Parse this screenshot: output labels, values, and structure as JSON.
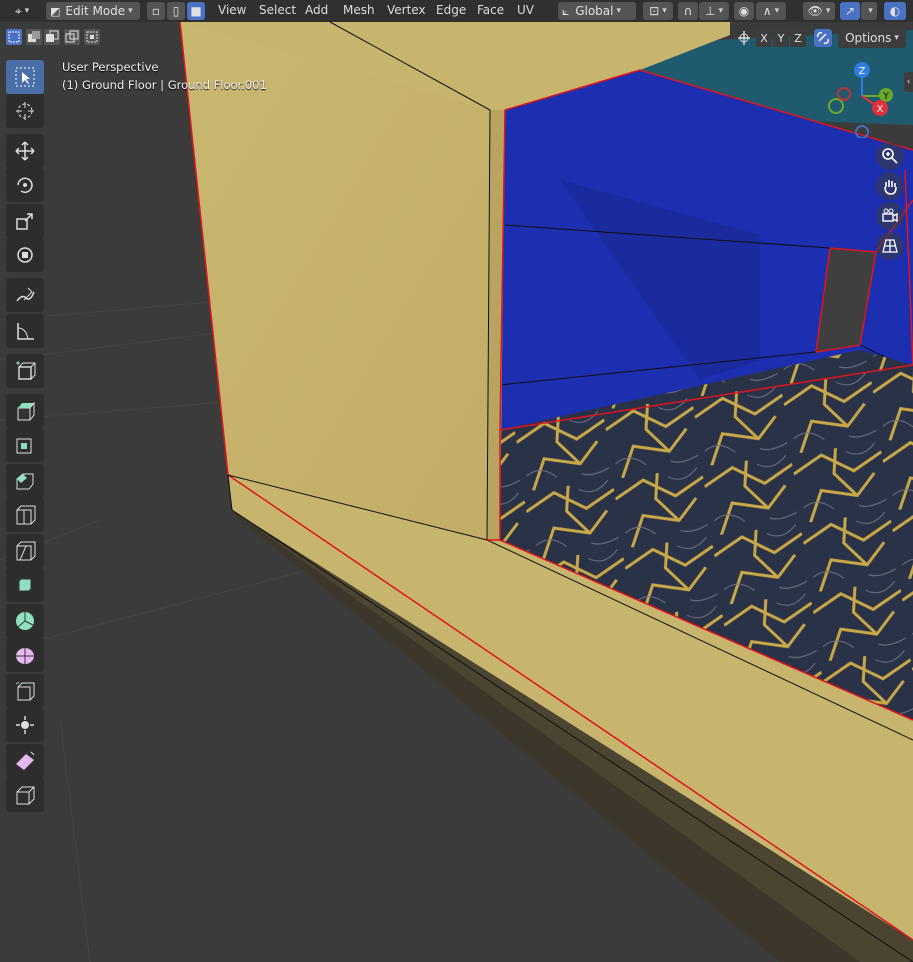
{
  "header": {
    "mode": "Edit Mode",
    "menus": [
      "View",
      "Select",
      "Add",
      "Mesh",
      "Vertex",
      "Edge",
      "Face",
      "UV"
    ],
    "orientation": "Global",
    "options_label": "Options",
    "axes": [
      "X",
      "Y",
      "Z"
    ]
  },
  "viewport": {
    "perspective_label": "User Perspective",
    "object_label": "(1) Ground Floor | Ground Floor.001"
  },
  "gizmo": {
    "z": "Z",
    "y": "Y",
    "x": "X"
  },
  "toolbar": {
    "tools": [
      "select-box",
      "cursor",
      "move",
      "rotate",
      "scale",
      "transform",
      "annotate",
      "measure",
      "add-cube",
      "extrude",
      "inset",
      "bevel",
      "loop-cut",
      "knife",
      "poly-build",
      "spin",
      "smooth",
      "edge-slide",
      "shrink-fatten",
      "shear",
      "rip"
    ]
  },
  "colors": {
    "selected_face": "#c8b56d",
    "selected_edge": "#e0141b",
    "wall_blue": "#1a2fa8",
    "floor_dark": "#2a3145",
    "floor_pattern": "#c9a848",
    "background": "#3b3b3b",
    "active_tool": "#4a6fa8"
  }
}
